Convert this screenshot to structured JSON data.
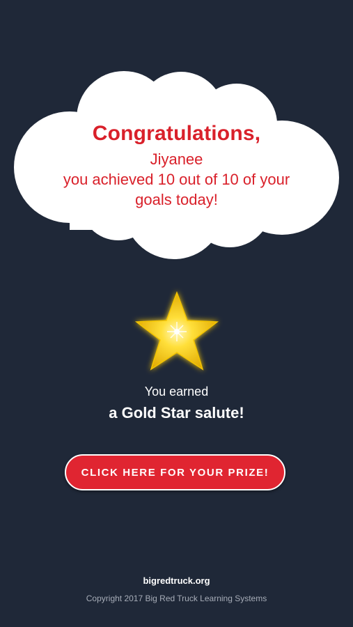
{
  "colors": {
    "background": "#1f2838",
    "accent_red": "#d9202a",
    "button_red": "#e02531",
    "cloud": "#ffffff",
    "star_gold": "#f5c518"
  },
  "message": {
    "title": "Congratulations,",
    "name": "Jiyanee",
    "line1": "you achieved 10 out of 10 of your",
    "line2": "goals today!"
  },
  "reward": {
    "icon": "gold-star-icon",
    "earned_line1": "You earned",
    "earned_line2": "a Gold Star salute!"
  },
  "prize_button": {
    "label": "CLICK HERE FOR YOUR PRIZE!"
  },
  "footer": {
    "link": "bigredtruck.org",
    "copyright": "Copyright 2017 Big Red Truck Learning Systems"
  }
}
